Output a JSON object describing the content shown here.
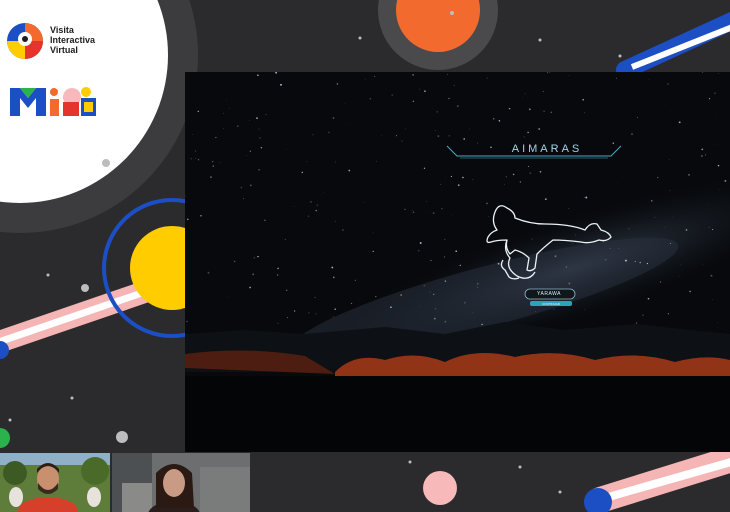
{
  "brand": {
    "lines": [
      "Visita",
      "Interactiva",
      "Virtual"
    ],
    "logo_icon": "map-pin-icon",
    "mia_logo": "mia-logo"
  },
  "screen": {
    "title": "AIMARAS",
    "constellation_icon": "llama-constellation-icon",
    "pill_label": "YARAWA",
    "pill_sub": "CONTINUAR"
  },
  "participants": [
    {
      "name": "participant-video-1"
    },
    {
      "name": "participant-video-2"
    }
  ],
  "colors": {
    "background": "#2b2b2d",
    "accent_orange": "#f26a2e",
    "accent_yellow": "#ffcc00",
    "accent_blue": "#1c4fc4",
    "accent_pink": "#f5b5b5",
    "title_cyan": "#9fd6e8"
  }
}
